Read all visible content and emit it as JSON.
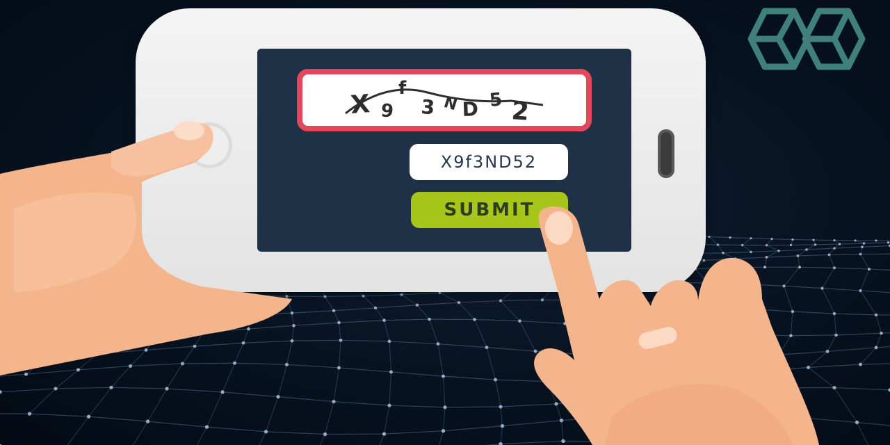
{
  "captcha": {
    "characters": [
      "X",
      "9",
      "f",
      "3",
      "N",
      "D",
      "5",
      "2"
    ]
  },
  "answer_field": {
    "value": "X9f3ND52"
  },
  "submit_button": {
    "label": "SUBMIT"
  },
  "colors": {
    "screen": "#1e3146",
    "captcha_border": "#e2485a",
    "submit": "#a7c51a",
    "logo": "#3f7f7c",
    "skin": "#f4b48c"
  },
  "icons": {
    "logo": "hexagon-cube-logo-icon"
  }
}
